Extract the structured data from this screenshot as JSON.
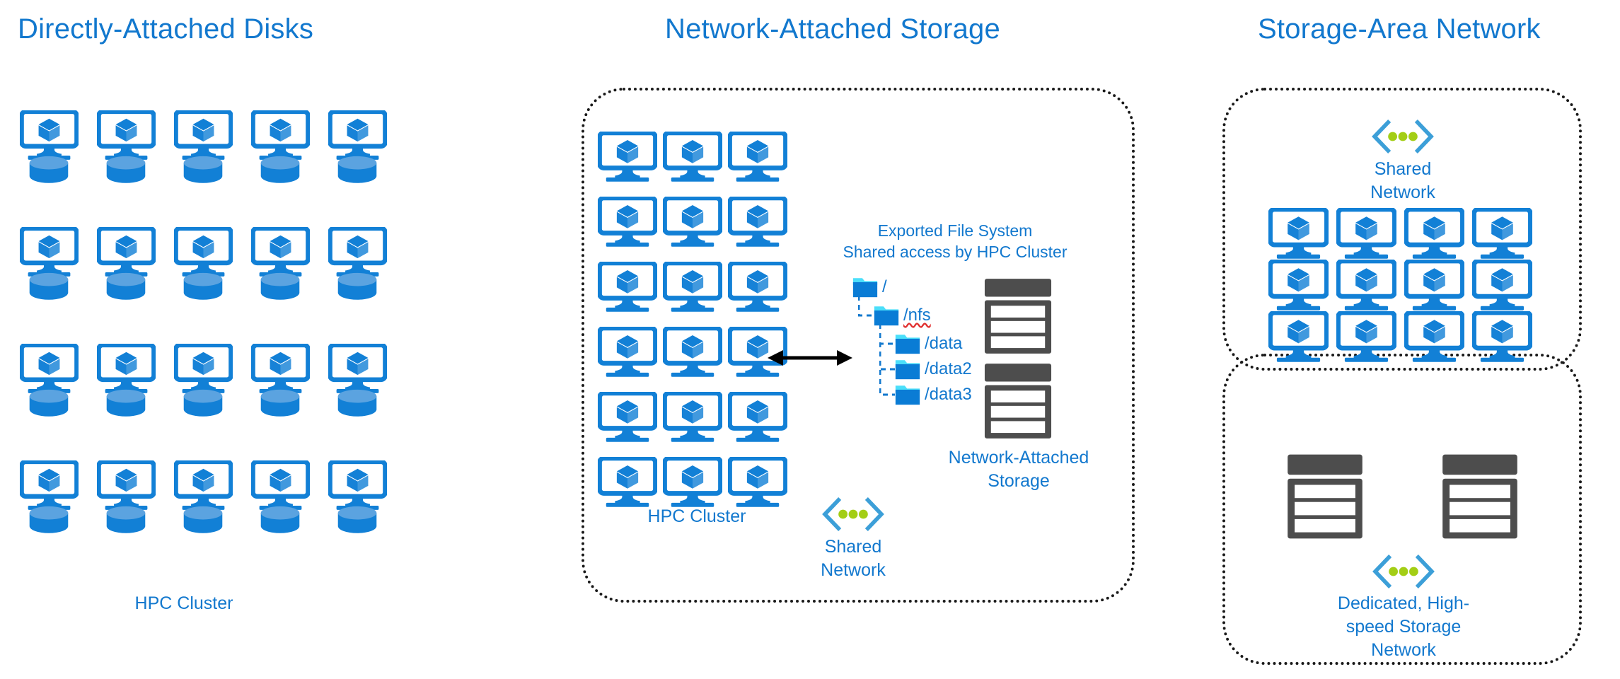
{
  "panels": {
    "directly_attached": {
      "title": "Directly-Attached Disks",
      "cluster_label": "HPC Cluster",
      "grid": {
        "cols": 5,
        "rows": 4,
        "node_icon": "vm-monitor-cube-icon",
        "disk_icon": "disk-cylinder-icon"
      }
    },
    "network_attached": {
      "title": "Network-Attached Storage",
      "cluster_label": "HPC Cluster",
      "grid": {
        "cols": 3,
        "rows": 6,
        "node_icon": "vm-monitor-cube-icon"
      },
      "fs_heading_line1": "Exported File System",
      "fs_heading_line2": "Shared access by HPC Cluster",
      "tree": [
        {
          "label": "/",
          "depth": 0,
          "misspelled": false
        },
        {
          "label": "/nfs",
          "depth": 1,
          "misspelled": true
        },
        {
          "label": "/data",
          "depth": 2,
          "misspelled": false
        },
        {
          "label": "/data2",
          "depth": 2,
          "misspelled": false
        },
        {
          "label": "/data3",
          "depth": 2,
          "misspelled": false
        }
      ],
      "storage_label_line1": "Network-Attached",
      "storage_label_line2": "Storage",
      "storage_units": 2,
      "network_label_line1": "Shared",
      "network_label_line2": "Network",
      "link_arrow": "double-headed-arrow"
    },
    "storage_area_network": {
      "title": "Storage-Area Network",
      "top_network_label_line1": "Shared",
      "top_network_label_line2": "Network",
      "grid": {
        "cols": 4,
        "rows": 3,
        "node_icon": "vm-monitor-cube-icon"
      },
      "storage_units": 2,
      "bottom_network_label_line1": "Dedicated, High-",
      "bottom_network_label_line2": "speed Storage",
      "bottom_network_label_line3": "Network"
    }
  },
  "colors": {
    "accent_blue": "#1278CE",
    "icon_blue": "#1280D6",
    "disk_top_blue": "#5BA3E0",
    "folder_tab_cyan": "#4BDFFA",
    "rack_gray": "#4D4D4D",
    "network_chevron_blue": "#3C9FD8",
    "network_dot_green": "#A3CE15",
    "arrow_black": "#000000",
    "dotted_border": "#1a1a1a",
    "background": "#FFFFFF"
  }
}
